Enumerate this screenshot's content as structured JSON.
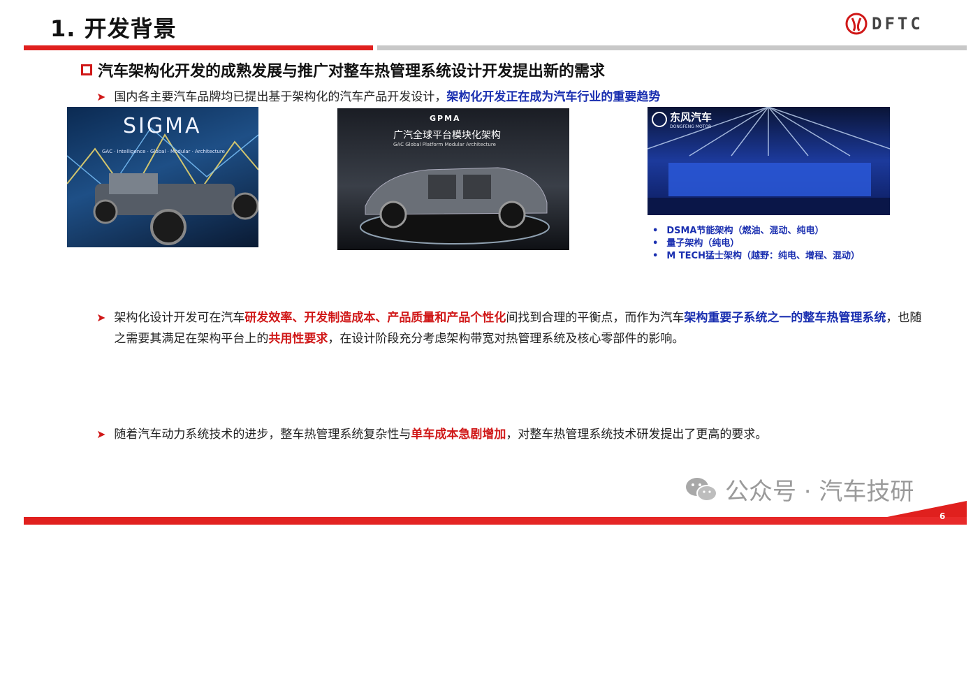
{
  "header": {
    "title": "1. 开发背景",
    "logo_text": "DFTC"
  },
  "section": {
    "heading": "汽车架构化开发的成熟发展与推广对整车热管理系统设计开发提出新的需求"
  },
  "bullets": {
    "b1": {
      "plain": "国内各主要汽车品牌均已提出基于架构化的汽车产品开发设计，",
      "emph_blue": "架构化开发正在成为汽车行业的重要趋势"
    },
    "b2": {
      "p1": "架构化设计开发可在汽车",
      "r1": "研发效率、开发制造成本、产品质量和产品个性化",
      "p2": "间找到合理的平衡点，而作为汽车",
      "bl1": "架构重要子系统之一的整车热管理系统",
      "p3": "，也随之需要其满足在架构平台上的",
      "r2": "共用性要求",
      "p4": "，在设计阶段充分考虑架构带宽对热管理系统及核心零部件的影响。"
    },
    "b3": {
      "p1": "随着汽车动力系统技术的进步，整车热管理系统复杂性与",
      "r1": "单车成本急剧增加",
      "p2": "，对整车热管理系统技术研发提出了更高的要求。"
    }
  },
  "images": {
    "sigma": {
      "title": "SIGMA",
      "subtitle": "GAC · Intelligence · Global · Modular · Architecture"
    },
    "gac": {
      "logo": "GPMA",
      "title": "广汽全球平台模块化架构",
      "subtitle": "GAC Global Platform Modular Architecture"
    },
    "dongfeng": {
      "brand": "东风汽车",
      "brand_en": "DONGFENG MOTOR"
    }
  },
  "architectures": [
    "DSMA节能架构（燃油、混动、纯电）",
    "量子架构（纯电）",
    "M TECH猛士架构（越野：纯电、增程、混动）"
  ],
  "watermark": "公众号 · 汽车技研",
  "footer": {
    "page_number": "6"
  },
  "colors": {
    "accent_red": "#d01818",
    "emph_blue": "#1a2fb0"
  }
}
